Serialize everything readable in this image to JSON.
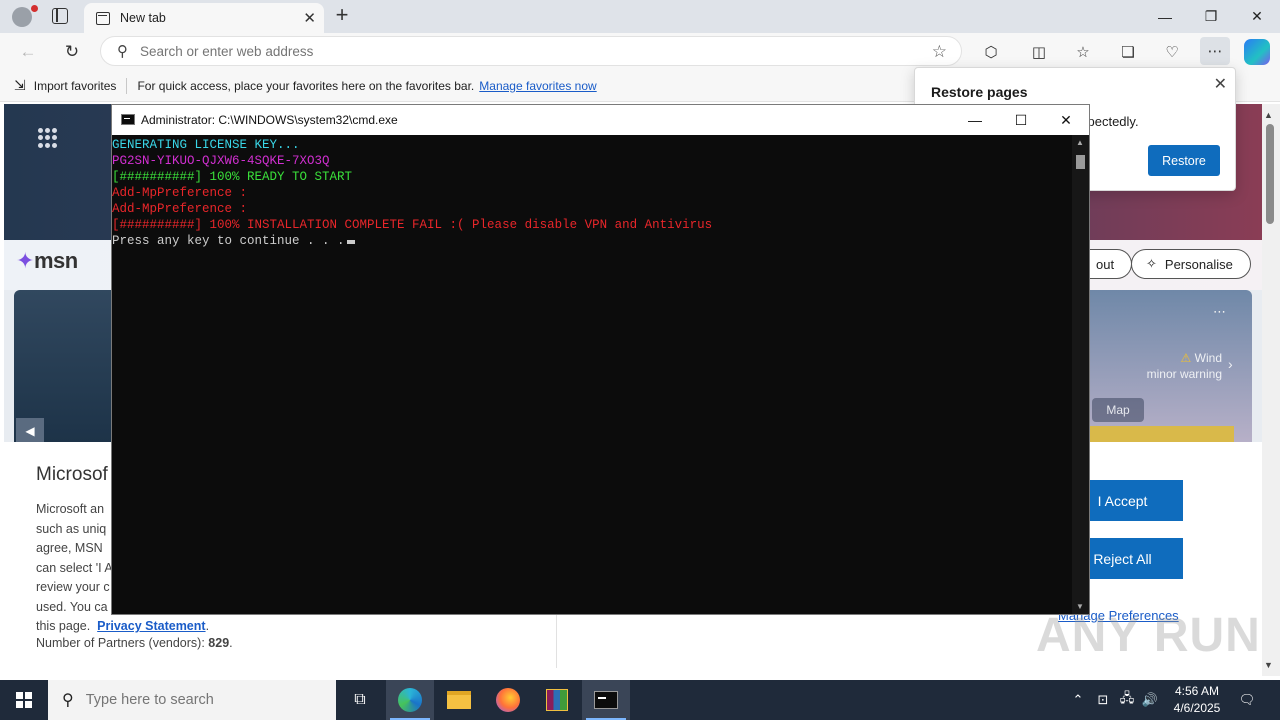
{
  "browser": {
    "tab_title": "New tab",
    "address_placeholder": "Search or enter web address",
    "favorites_bar": {
      "import_label": "Import favorites",
      "hint": "For quick access, place your favorites here on the favorites bar.",
      "manage_link": "Manage favorites now"
    },
    "restore_popup": {
      "title": "Restore pages",
      "message_visible": "xpectedly.",
      "button": "Restore"
    }
  },
  "msn": {
    "logo": "msn",
    "pill_partial": "out",
    "personalise": "Personalise",
    "weather_title": "Wind",
    "weather_sub": "minor warning",
    "map_label": "Map",
    "consent": {
      "title": "Microsof",
      "body_lines": [
        "Microsoft an",
        "such as uniq",
        "agree, MSN",
        "can select 'I A",
        "review your c",
        "used.  You ca",
        "this page."
      ],
      "privacy_link": "Privacy Statement",
      "partners_label": "Number of Partners (vendors):",
      "partners_count": "829",
      "accept": "I Accept",
      "reject": "Reject All",
      "manage": "Manage Preferences"
    }
  },
  "cmd": {
    "title": "Administrator: C:\\WINDOWS\\system32\\cmd.exe",
    "lines": [
      {
        "text": "GENERATING LICENSE KEY...",
        "color": "#3ad7e8"
      },
      {
        "text": "PG2SN-YIKUO-QJXW6-4SQKE-7XO3Q",
        "color": "#d12fd1"
      },
      {
        "text": "[##########] 100% READY TO START",
        "color": "#3ae03a"
      },
      {
        "text": "Add-MpPreference :",
        "color": "#e8262a"
      },
      {
        "text": "Add-MpPreference :",
        "color": "#e8262a"
      },
      {
        "text": "[##########] 100% INSTALLATION COMPLETE FAIL :( Please disable VPN and Antivirus",
        "color": "#e8262a"
      },
      {
        "text": "Press any key to continue . . .",
        "color": "#cccccc"
      }
    ]
  },
  "taskbar": {
    "search_placeholder": "Type here to search",
    "time": "4:56 AM",
    "date": "4/6/2025"
  },
  "watermark": "ANY RUN"
}
